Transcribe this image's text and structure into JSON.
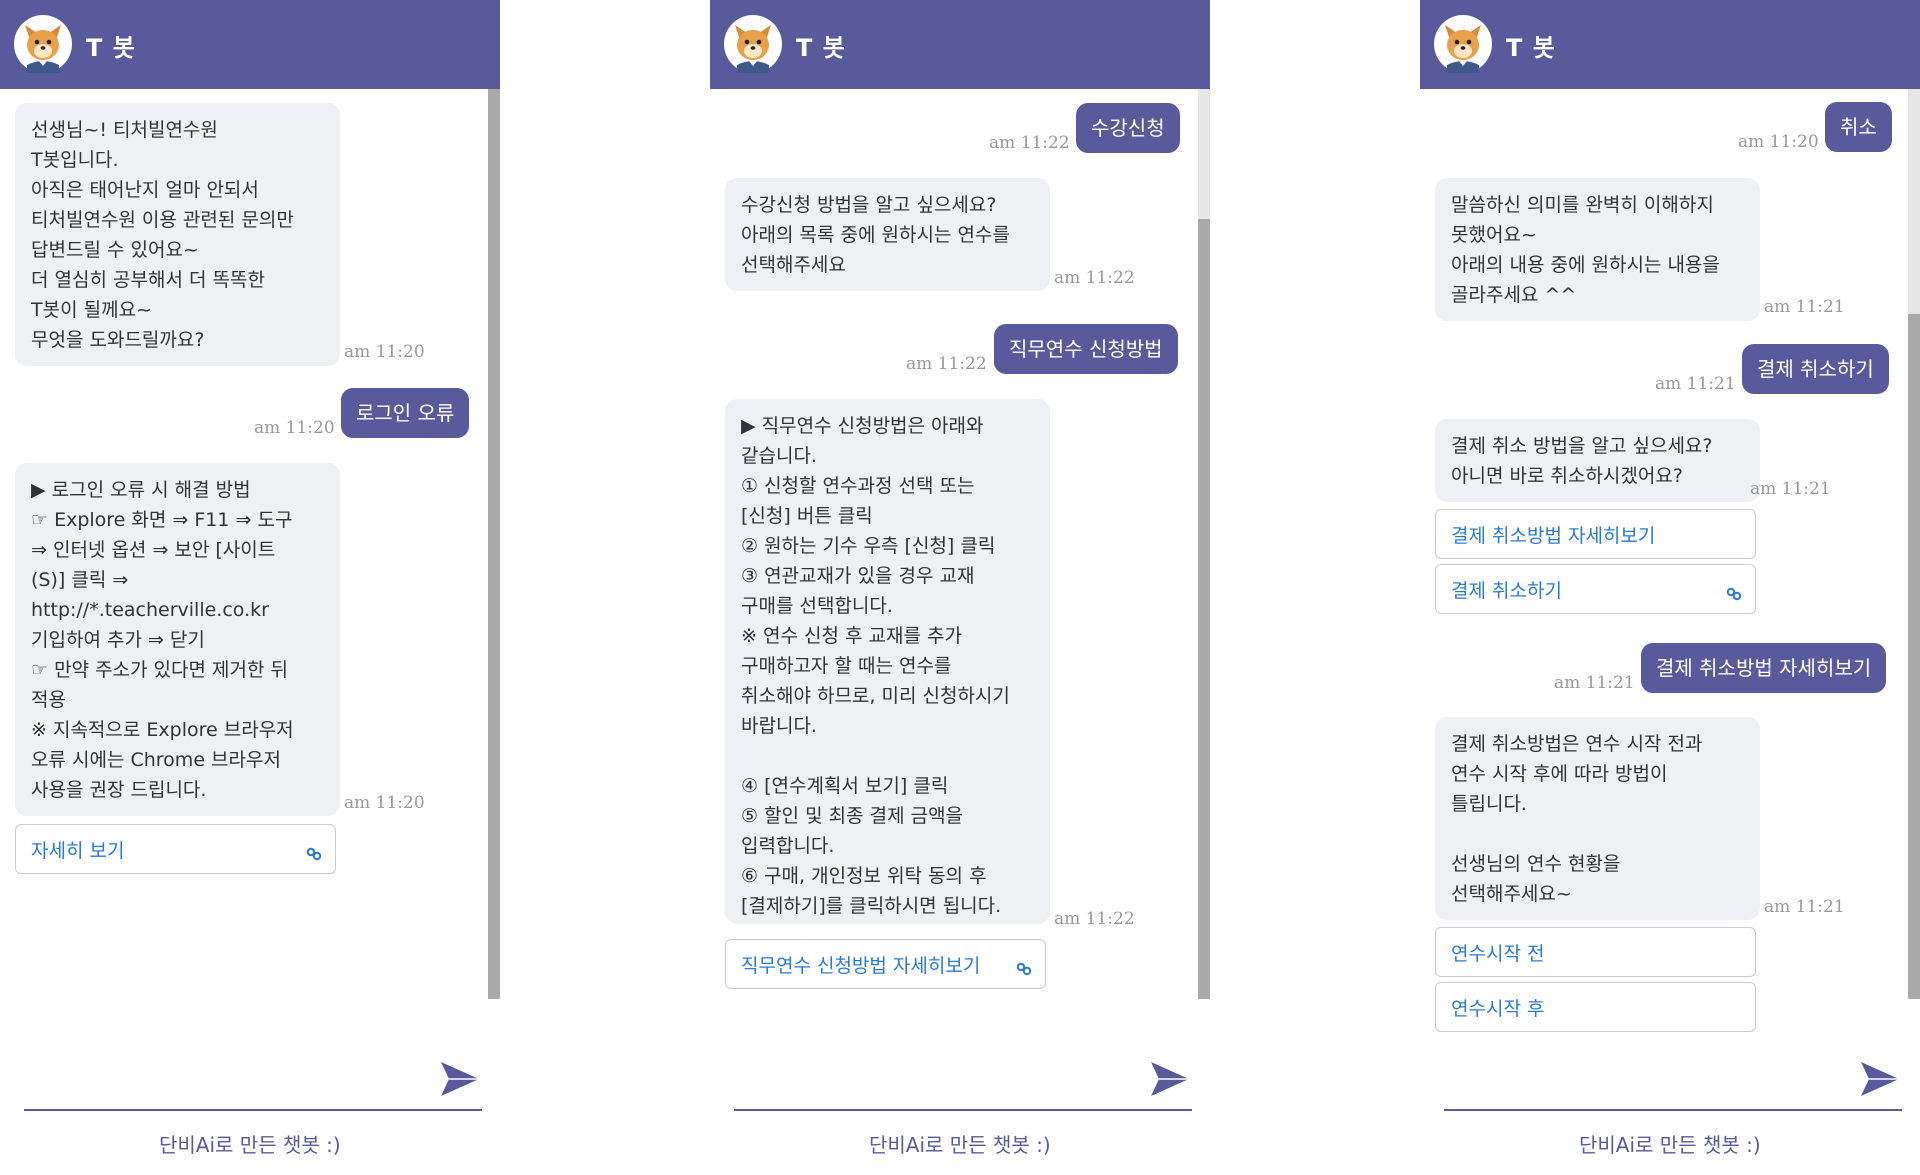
{
  "bot_name": "T 봇",
  "footer": "단비Ai로 만든 챗봇 :)",
  "colors": {
    "header": "#585a9c",
    "bot_bubble": "#eef0f3",
    "link": "#2a7ad8"
  },
  "icons": {
    "avatar": "dog-mascot-avatar",
    "send": "paper-plane-send-icon",
    "link": "link-chain-icon"
  },
  "panel1": {
    "msg1": "선생님~! 티처빌연수원\nT봇입니다.\n아직은 태어난지 얼마 안되서\n티처빌연수원 이용 관련된 문의만\n답변드릴 수 있어요~\n더 열심히 공부해서 더 똑똑한\nT봇이 될께요~\n무엇을 도와드릴까요?",
    "time1": "am 11:20",
    "user1": "로그인 오류",
    "time_user1": "am 11:20",
    "msg2": "▶ 로그인 오류 시 해결 방법\n☞ Explore 화면 ⇒ F11 ⇒ 도구\n⇒ 인터넷 옵션 ⇒ 보안 [사이트\n(S)] 클릭 ⇒\nhttp://*.teacherville.co.kr\n기입하여 추가 ⇒ 닫기\n☞ 만약 주소가 있다면 제거한 뒤\n적용\n※ 지속적으로 Explore 브라우저\n오류 시에는 Chrome 브라우저\n사용을 권장 드립니다.",
    "time2": "am 11:20",
    "link1": "자세히 보기"
  },
  "panel2": {
    "user1": "수강신청",
    "time_user1": "am 11:22",
    "msg1": "수강신청 방법을 알고 싶으세요?\n아래의 목록 중에 원하시는 연수를\n선택해주세요",
    "time1": "am 11:22",
    "user2": "직무연수 신청방법",
    "time_user2": "am 11:22",
    "msg2": "▶ 직무연수 신청방법은 아래와\n같습니다.\n① 신청할 연수과정 선택 또는\n[신청] 버튼 클릭\n② 원하는 기수 우측 [신청] 클릭\n③ 연관교재가 있을 경우 교재\n구매를 선택합니다.\n※ 연수 신청 후 교재를 추가\n구매하고자 할 때는 연수를\n취소해야 하므로, 미리 신청하시기\n바랍니다.\n\n④ [연수계획서 보기] 클릭\n⑤ 할인 및 최종 결제 금액을\n입력합니다.\n⑥ 구매, 개인정보 위탁 동의 후\n[결제하기]를 클릭하시면 됩니다.",
    "time2": "am 11:22",
    "link1": "직무연수 신청방법 자세히보기"
  },
  "panel3": {
    "user1": "취소",
    "time_user1": "am 11:20",
    "msg1": "말씀하신 의미를 완벽히 이해하지\n못했어요~\n아래의 내용 중에 원하시는 내용을\n골라주세요 ^^",
    "time1": "am 11:21",
    "user2": "결제 취소하기",
    "time_user2": "am 11:21",
    "msg2": "결제 취소 방법을 알고 싶으세요?\n아니면 바로 취소하시겠어요?",
    "time2": "am 11:21",
    "link1": "결제 취소방법 자세히보기",
    "link2": "결제 취소하기",
    "user3": "결제 취소방법 자세히보기",
    "time_user3": "am 11:21",
    "msg3": "결제 취소방법은 연수 시작 전과\n연수 시작 후에 따라 방법이\n틀립니다.\n\n선생님의 연수 현황을\n선택해주세요~",
    "time3": "am 11:21",
    "link3": "연수시작 전",
    "link4": "연수시작 후"
  }
}
